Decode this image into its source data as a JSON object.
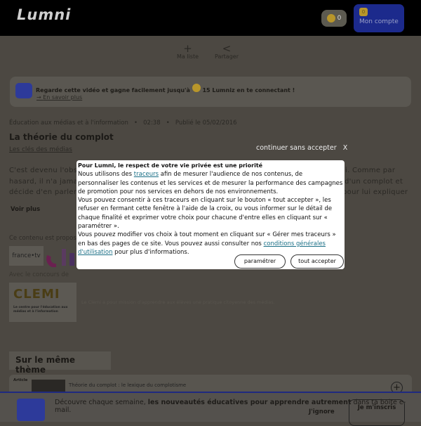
{
  "header": {
    "logo": "Lumni",
    "coins": "0",
    "account_coins": "0",
    "account_label": "Mon compte"
  },
  "toolbar": {
    "add": "Ma liste",
    "share": "Partager"
  },
  "banner": {
    "text_before": "Regarde cette vidéo et gagne facilement jusqu'à",
    "text_bold": "15 Lumniz en te connectant !",
    "link": "En savoir plus"
  },
  "meta": {
    "category": "Éducation aux médias et à l'information",
    "duration": "02:38",
    "published": "Publié le 05/02/2016"
  },
  "title": "La théorie du complot",
  "series": "Les clés des médias",
  "paragraph": [
    {
      "left": "C'est devenu l'obs",
      "right": "i.  Comme par"
    },
    {
      "left": "hasard, il n'a jamai",
      "right": "d'un complot et"
    },
    {
      "left": "décide d'en parler",
      "right": "pour lui expliquer"
    }
  ],
  "voir_plus": "Voir plus",
  "partners": {
    "label": "Ce contenu est propos",
    "francetv": "france•tv",
    "concours": "Avec le concours de",
    "clemi_logo": "CLEMI",
    "clemi_sub": "Le centre pour l'éducation aux médias et à l'information",
    "clemi_desc": "Le Clemi a pour mission d'apprendre aux élèves une pratique citoyenne des médias."
  },
  "same_theme": {
    "heading": "Sur le même thème",
    "card_tag": "Article",
    "card_title": "Théorie du complot : le lexique du complotisme"
  },
  "newsletter": {
    "text1": "Découvre chaque semaine, ",
    "bold": "les nouveautés éducatives pour apprendre autrement",
    "text2": " dans ta boite e-mail.",
    "ignore": "J'ignore",
    "subscribe": "Je m'inscris"
  },
  "consent": {
    "continue": "continuer sans accepter",
    "close": "X",
    "title": "Pour Lumni, le respect de votre vie privée est une priorité",
    "p1a": "Nous utilisons des ",
    "p1link": "traceurs",
    "p1b": " afin de mesurer l'audience de nos contenus, de personnaliser les contenus et les services et de mesurer la performance des campagnes de promotion pour nos services en dehors de nos environnements.",
    "p2": "Vous pouvez consentir à ces traceurs en cliquant sur le bouton « tout accepter », les refuser en fermant cette fenêtre à l'aide de la croix, ou vous informer sur le détail de chaque finalité et exprimer votre choix pour chacune d'entre elles en cliquant sur « paramétrer ».",
    "p3a": "Vous pouvez modifier vos choix à tout moment en cliquant sur « Gérer mes traceurs » en bas des pages de ce site. Vous pouvez aussi consulter nos ",
    "p3link": "conditions générales d'utilisation",
    "p3b": " pour plus d'informations.",
    "settings": "paramétrer",
    "accept": "tout accepter"
  },
  "colors": {
    "header": "#000000",
    "account": "#1c2a8c",
    "link": "#1a6f86"
  }
}
